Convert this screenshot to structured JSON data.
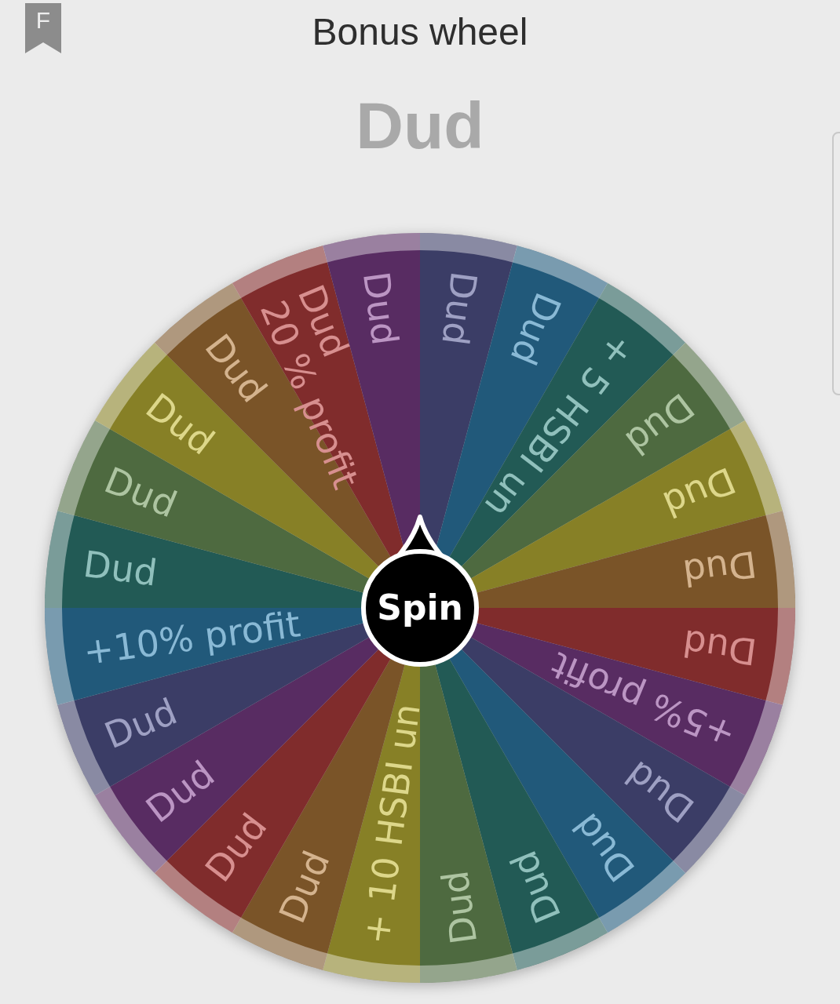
{
  "header": {
    "badge": "F",
    "title": "Bonus wheel"
  },
  "result": "Dud",
  "wheel": {
    "spin_label": "Spin",
    "segments": [
      {
        "lines": [
          "Dud"
        ],
        "color": "#3b3d66"
      },
      {
        "lines": [
          "Dud"
        ],
        "color": "#21597a"
      },
      {
        "lines": [
          "+ 5 HSBI un"
        ],
        "color": "#225a55"
      },
      {
        "lines": [
          "Dud"
        ],
        "color": "#4e6a40"
      },
      {
        "lines": [
          "Dud"
        ],
        "color": "#878026"
      },
      {
        "lines": [
          "Dud"
        ],
        "color": "#7a5428"
      },
      {
        "lines": [
          "Dud"
        ],
        "color": "#802c2c"
      },
      {
        "lines": [
          "+5% profit"
        ],
        "color": "#582c62"
      },
      {
        "lines": [
          "Dud"
        ],
        "color": "#3b3d66"
      },
      {
        "lines": [
          "Dud"
        ],
        "color": "#21597a"
      },
      {
        "lines": [
          "Dud"
        ],
        "color": "#225a55"
      },
      {
        "lines": [
          "Dud"
        ],
        "color": "#4e6a40"
      },
      {
        "lines": [
          "+ 10 HSBI un"
        ],
        "color": "#878026"
      },
      {
        "lines": [
          "Dud"
        ],
        "color": "#7a5428"
      },
      {
        "lines": [
          "Dud"
        ],
        "color": "#802c2c"
      },
      {
        "lines": [
          "Dud"
        ],
        "color": "#582c62"
      },
      {
        "lines": [
          "Dud"
        ],
        "color": "#3b3d66"
      },
      {
        "lines": [
          "+10% profit"
        ],
        "color": "#21597a"
      },
      {
        "lines": [
          "Dud"
        ],
        "color": "#225a55"
      },
      {
        "lines": [
          "Dud"
        ],
        "color": "#4e6a40"
      },
      {
        "lines": [
          "Dud"
        ],
        "color": "#878026"
      },
      {
        "lines": [
          "Dud"
        ],
        "color": "#7a5428"
      },
      {
        "lines": [
          "Dud",
          "20 % profit"
        ],
        "color": "#802c2c"
      },
      {
        "lines": [
          "Dud"
        ],
        "color": "#582c62"
      }
    ]
  }
}
